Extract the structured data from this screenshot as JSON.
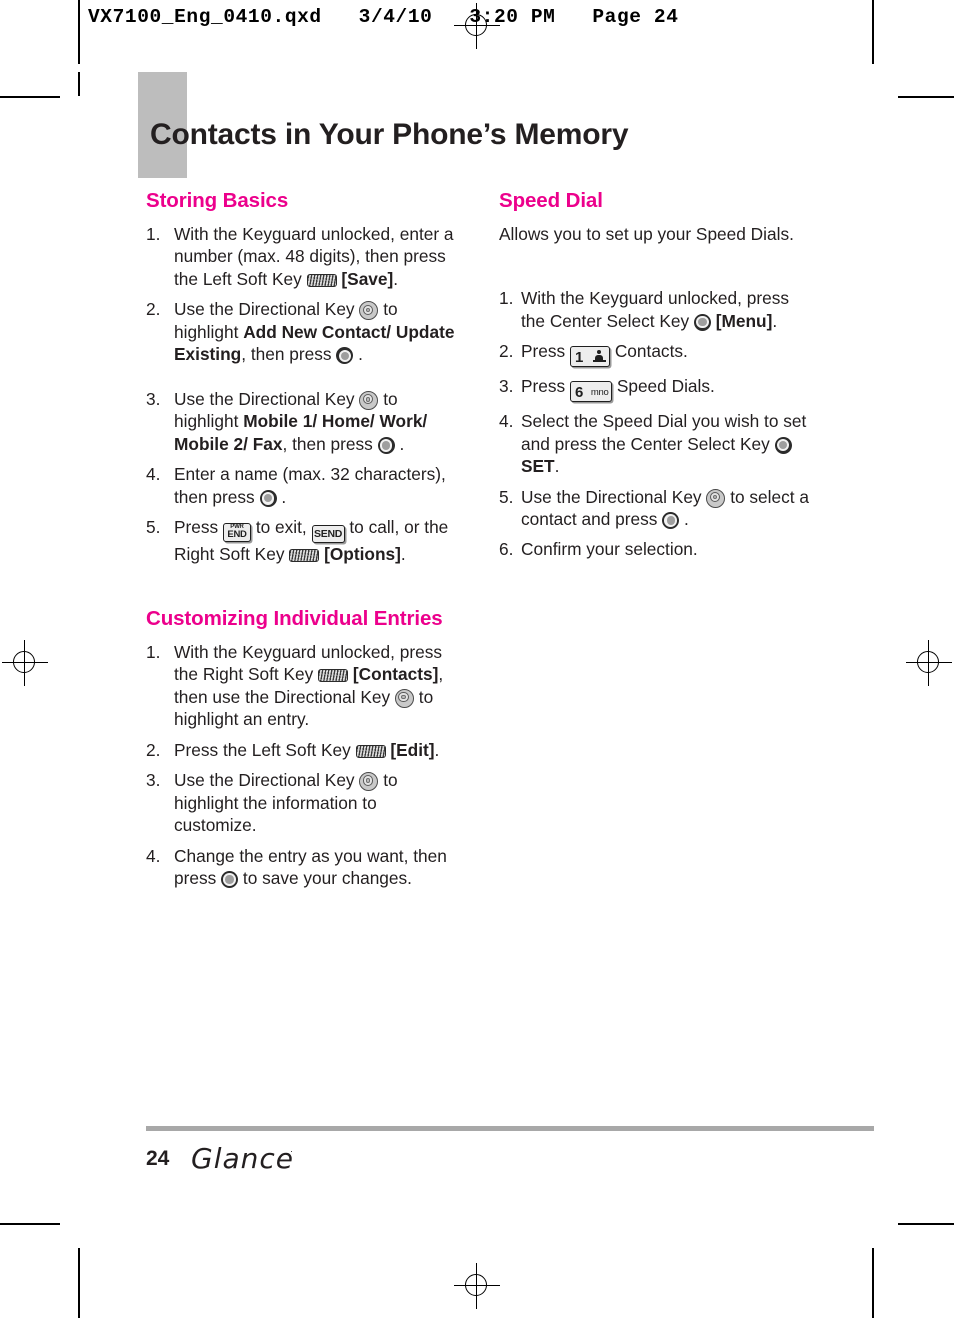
{
  "file_header": "VX7100_Eng_0410.qxd   3/4/10   3:20 PM   Page 24",
  "page_title": "Contacts in Your Phone’s Memory",
  "accent_color": "#ec008c",
  "left_column": {
    "sections": [
      {
        "heading": "Storing Basics",
        "steps": [
          "1.",
          "2.",
          "3.",
          "4.",
          "5."
        ],
        "step_text": {
          "s1_a": "With the Keyguard unlocked, enter a number (max. 48 digits), then press the Left Soft Key",
          "s1_b": "[Save]",
          "s1_c": ".",
          "s2_a": "Use the Directional Key",
          "s2_b": "to highlight",
          "s2_c": "Add New Contact/",
          "s2_d": "Update Existing",
          "s2_e": ", then press",
          "s2_f": ".",
          "s3_a": "Use the Directional Key",
          "s3_b": "to highlight",
          "s3_c": "Mobile 1/ Home/ Work/",
          "s3_d": "Mobile 2/ Fax",
          "s3_e": ", then press",
          "s3_f": ".",
          "s4_a": "Enter a name (max. 32 characters), then press",
          "s4_b": ".",
          "s5_a": "Press",
          "s5_b": "to exit,",
          "s5_c": "to call, or the Right Soft Key",
          "s5_d": "[Options]",
          "s5_e": "."
        }
      },
      {
        "heading": "Customizing Individual Entries",
        "steps": [
          "1.",
          "2.",
          "3.",
          "4."
        ],
        "step_text": {
          "c1_a": "With the Keyguard unlocked, press the Right Soft Key",
          "c1_b": "[Contacts]",
          "c1_c": ", then use the Directional Key",
          "c1_d": "to highlight an entry.",
          "c2_a": "Press the Left Soft Key",
          "c2_b": "[Edit]",
          "c2_c": ".",
          "c3_a": "Use the Directional Key",
          "c3_b": "to highlight the information to customize.",
          "c4_a": "Change the entry as you want, then press",
          "c4_b": "to save your changes."
        }
      }
    ]
  },
  "right_column": {
    "sections": [
      {
        "heading": "Speed Dial",
        "lead": "Allows you to set up your Speed Dials.",
        "steps": [
          "1.",
          "2.",
          "3.",
          "4.",
          "5.",
          "6."
        ],
        "step_text": {
          "d1_a": "With the Keyguard unlocked, press the Center Select Key",
          "d1_b": "[Menu]",
          "d1_c": ".",
          "d2_a": "Press",
          "d2_b": "Contacts.",
          "d3_a": "Press",
          "d3_b": "Speed Dials.",
          "d4_a": "Select the Speed Dial you wish to set and press the Center Select Key",
          "d4_b": "SET",
          "d4_c": ".",
          "d5_a": "Use the Directional Key",
          "d5_b": "to select a contact and press",
          "d5_c": ".",
          "d6_a": "Confirm your selection."
        }
      }
    ]
  },
  "keys": {
    "end_line1": "PWR",
    "end_line2": "END",
    "send": "SEND",
    "digit_1": "1",
    "digit_1_sub": "",
    "digit_6": "6",
    "digit_6_sub": "mno"
  },
  "footer": {
    "page_number": "24",
    "logo": "Glance",
    "trademark": "·"
  }
}
